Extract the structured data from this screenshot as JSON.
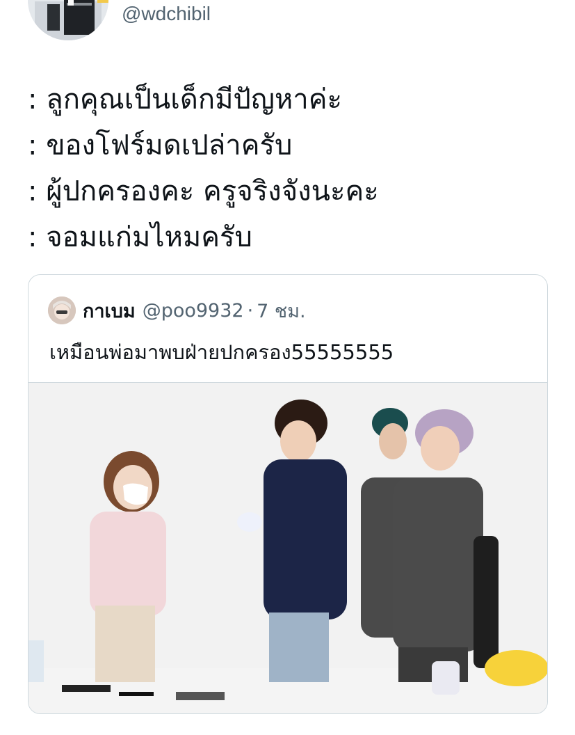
{
  "author": {
    "handle": "@wdchibil"
  },
  "tweet": {
    "lines": [
      ": ลูกคุณเป็นเด็กมีปัญหาค่ะ",
      ": ของโฟร์มดเปล่าครับ",
      ": ผู้ปกครองคะ ครูจริงจังนะคะ",
      ": จอมแก่มไหมครับ"
    ]
  },
  "quote": {
    "name": "กาเบม",
    "handle": "@poo9932",
    "separator": "·",
    "time": "7 ชม.",
    "text": "เหมือนพ่อมาพบฝ่ายปกครอง55555555"
  },
  "colors": {
    "text_primary": "#0f1419",
    "text_secondary": "#536471",
    "border": "#cfd9de"
  }
}
